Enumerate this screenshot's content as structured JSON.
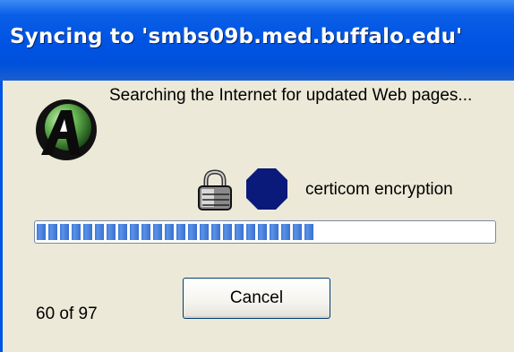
{
  "window": {
    "title": "Syncing to 'smbs09b.med.buffalo.edu'"
  },
  "status": {
    "message": "Searching the Internet for updated Web pages..."
  },
  "encryption": {
    "label": "certicom encryption"
  },
  "progress": {
    "current": 60,
    "total": 97,
    "fraction": 0.62,
    "counter_text": "60 of 97"
  },
  "buttons": {
    "cancel_label": "Cancel"
  },
  "icons": {
    "app": "internet-explorer-style-globe-icon",
    "lock": "padlock-icon",
    "certicom": "certicom-octagon-icon"
  },
  "colors": {
    "titlebar": "#0054e3",
    "dialog_background": "#ece9d8",
    "progress_block": "#3d79d8",
    "certicom_octagon": "#0a1a7a"
  }
}
